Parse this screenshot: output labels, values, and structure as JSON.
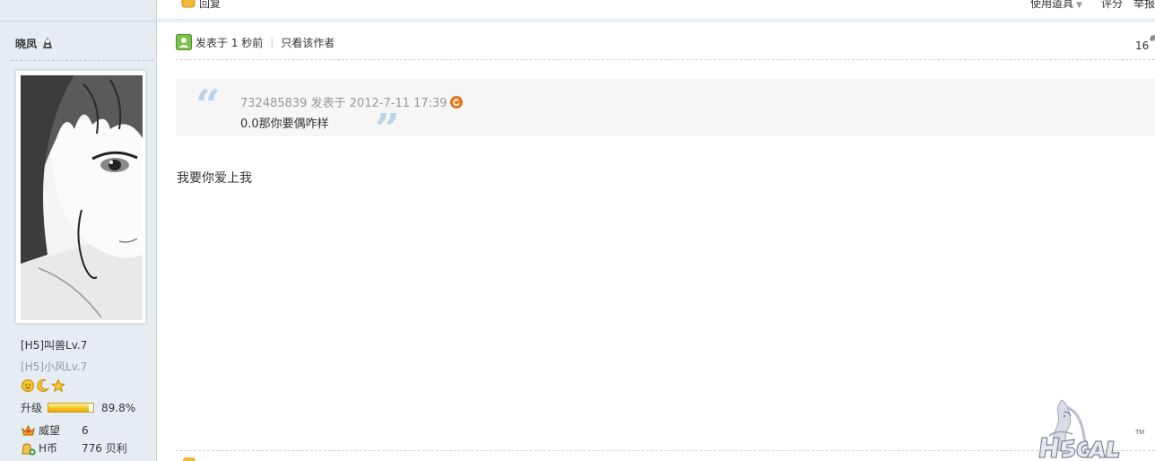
{
  "topbar": {
    "reply_label": "回复",
    "tools_label": "使用道具",
    "rate_label": "评分",
    "report_label": "举报"
  },
  "user": {
    "name": "晓凤",
    "rank_primary": "[H5]叫兽Lv.7",
    "rank_secondary": "[H5]小风Lv.7",
    "level_label": "升级",
    "level_progress_pct": 89.8,
    "level_progress_text": "89.8%",
    "stats": [
      {
        "name": "威望",
        "value": "6",
        "icon": "crown-icon"
      },
      {
        "name": "H币",
        "value": "776 贝利",
        "icon": "coin-bag-icon"
      }
    ],
    "badge_icons": [
      "sun-icon",
      "moon-icon",
      "star-icon"
    ]
  },
  "post": {
    "posted_at": "发表于 1 秒前",
    "only_author_label": "只看该作者",
    "floor_number": "16",
    "floor_mark": "#",
    "quote": {
      "author_meta": "732485839 发表于 2012-7-11 17:39",
      "text": "0.0那你要偶咋样"
    },
    "body": "我要你爱上我"
  },
  "colors": {
    "sidebar_bg": "#e5edf2",
    "quote_bg": "#f6f6f6",
    "quote_mark": "#b9d3ea",
    "progress_fill": "#f5c418"
  }
}
